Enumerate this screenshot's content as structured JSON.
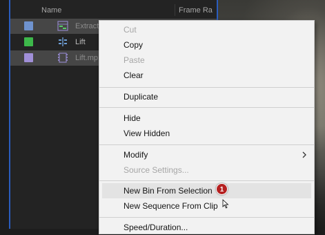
{
  "project_panel": {
    "columns": {
      "name": "Name",
      "frame_rate": "Frame Ra"
    },
    "items": [
      {
        "name": "Extract",
        "label_color": "#6f93cf",
        "icon": "sequence-icon",
        "selected": true
      },
      {
        "name": "Lift",
        "label_color": "#3db84a",
        "icon": "trim-clip-icon",
        "selected": false
      },
      {
        "name": "Lift.mp",
        "label_color": "#a08fd8",
        "icon": "video-clip-icon",
        "selected": true
      }
    ]
  },
  "context_menu": {
    "items": [
      {
        "label": "Cut",
        "enabled": false
      },
      {
        "label": "Copy",
        "enabled": true
      },
      {
        "label": "Paste",
        "enabled": false
      },
      {
        "label": "Clear",
        "enabled": true
      },
      {
        "label": "Duplicate",
        "enabled": true
      },
      {
        "label": "Hide",
        "enabled": true
      },
      {
        "label": "View Hidden",
        "enabled": true
      },
      {
        "label": "Modify",
        "enabled": true,
        "submenu": true
      },
      {
        "label": "Source Settings...",
        "enabled": false
      },
      {
        "label": "New Bin From Selection",
        "enabled": true,
        "hovered": true
      },
      {
        "label": "New Sequence From Clip",
        "enabled": true
      },
      {
        "label": "Speed/Duration...",
        "enabled": true
      }
    ]
  },
  "annotation": {
    "step_badge": "1",
    "color": "#b52020"
  }
}
